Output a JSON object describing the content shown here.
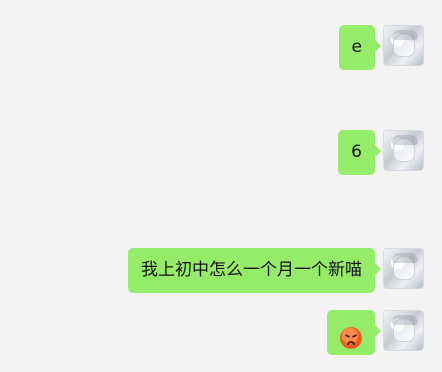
{
  "chat": {
    "messages": [
      {
        "text": "e"
      },
      {
        "text": "6"
      },
      {
        "text": "我上初中怎么一个月一个新喵"
      },
      {
        "text": "",
        "emoji": "angry-face-emoji"
      }
    ]
  }
}
